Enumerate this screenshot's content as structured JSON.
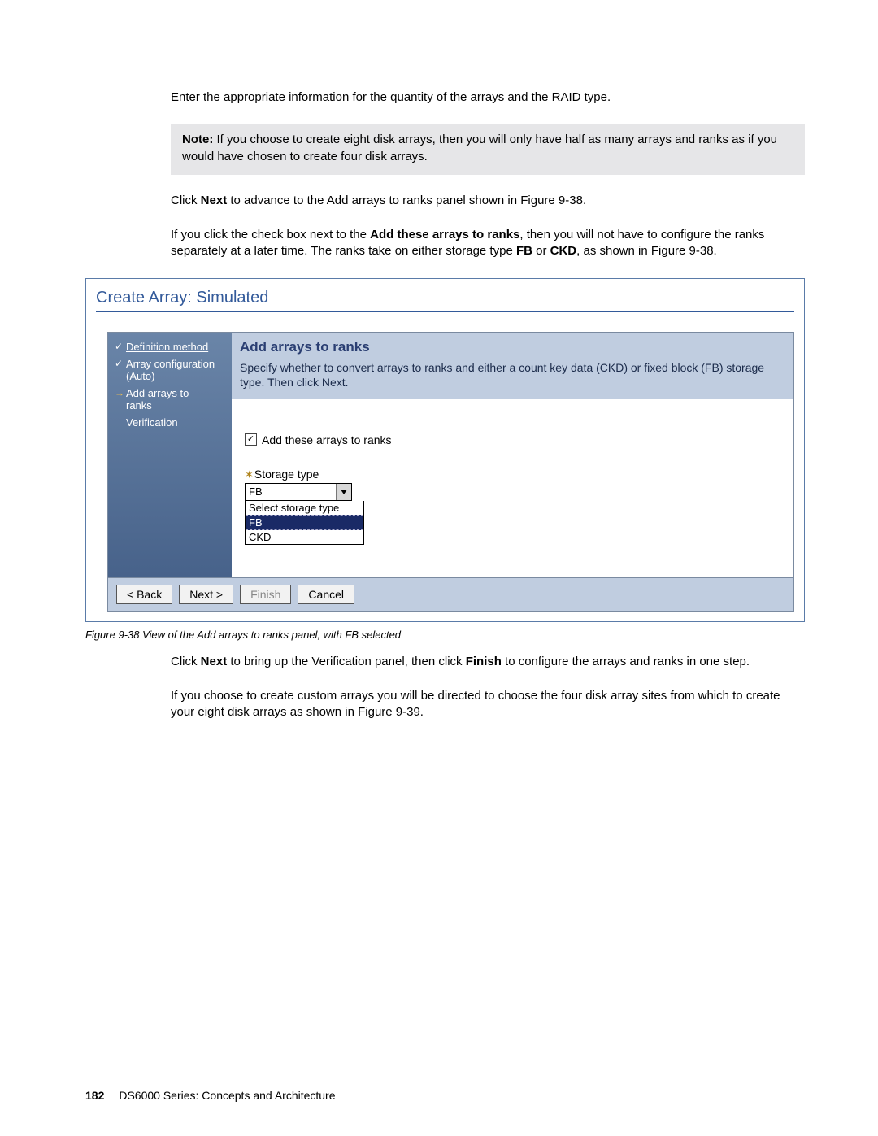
{
  "para1": "Enter the appropriate information for the quantity of the arrays and the RAID type.",
  "note_bold": "Note:",
  "note_text": " If you choose to create eight disk arrays, then you will only have half as many arrays and ranks as if you would have chosen to create four disk arrays.",
  "para2_pre": "Click ",
  "para2_bold": "Next",
  "para2_post": " to advance to the Add arrays to ranks panel shown in Figure 9-38.",
  "para3_pre": "If you click the check box next to the ",
  "para3_bold1": "Add these arrays to ranks",
  "para3_mid": ", then you will not have to configure the ranks separately at a later time. The ranks take on either storage type ",
  "para3_bold2": "FB",
  "para3_mid2": " or ",
  "para3_bold3": "CKD",
  "para3_post": ", as shown in Figure 9-38.",
  "fig_title": "Create Array: Simulated",
  "steps": {
    "s1": "Definition method",
    "s2a": "Array configuration",
    "s2b": "(Auto)",
    "s3a": "Add arrays to",
    "s3b": "ranks",
    "s4": "Verification"
  },
  "icons": {
    "check": "✓",
    "arrow": "→"
  },
  "panel": {
    "title": "Add arrays to ranks",
    "desc": "Specify whether to convert arrays to ranks and either a count key data (CKD) or fixed block (FB) storage type. Then click Next.",
    "cb_label": "Add these arrays to ranks",
    "storage_label": "Storage type",
    "selected": "FB",
    "opts": {
      "o1": "Select storage type",
      "o2": "FB",
      "o3": "CKD"
    }
  },
  "buttons": {
    "back": "< Back",
    "next": "Next >",
    "finish": "Finish",
    "cancel": "Cancel"
  },
  "caption_pre": "Figure 9-38   ",
  "caption": "View of the Add arrays to ranks panel, with FB selected",
  "para4_pre": "Click ",
  "para4_b1": "Next",
  "para4_mid": " to bring up the Verification panel, then click ",
  "para4_b2": "Finish",
  "para4_post": " to configure the arrays and ranks in one step.",
  "para5": "If you choose to create custom arrays you will be directed to choose the four disk array sites from which to create your eight disk arrays as shown in Figure 9-39.",
  "footer": {
    "page": "182",
    "book": "DS6000 Series: Concepts and Architecture"
  }
}
